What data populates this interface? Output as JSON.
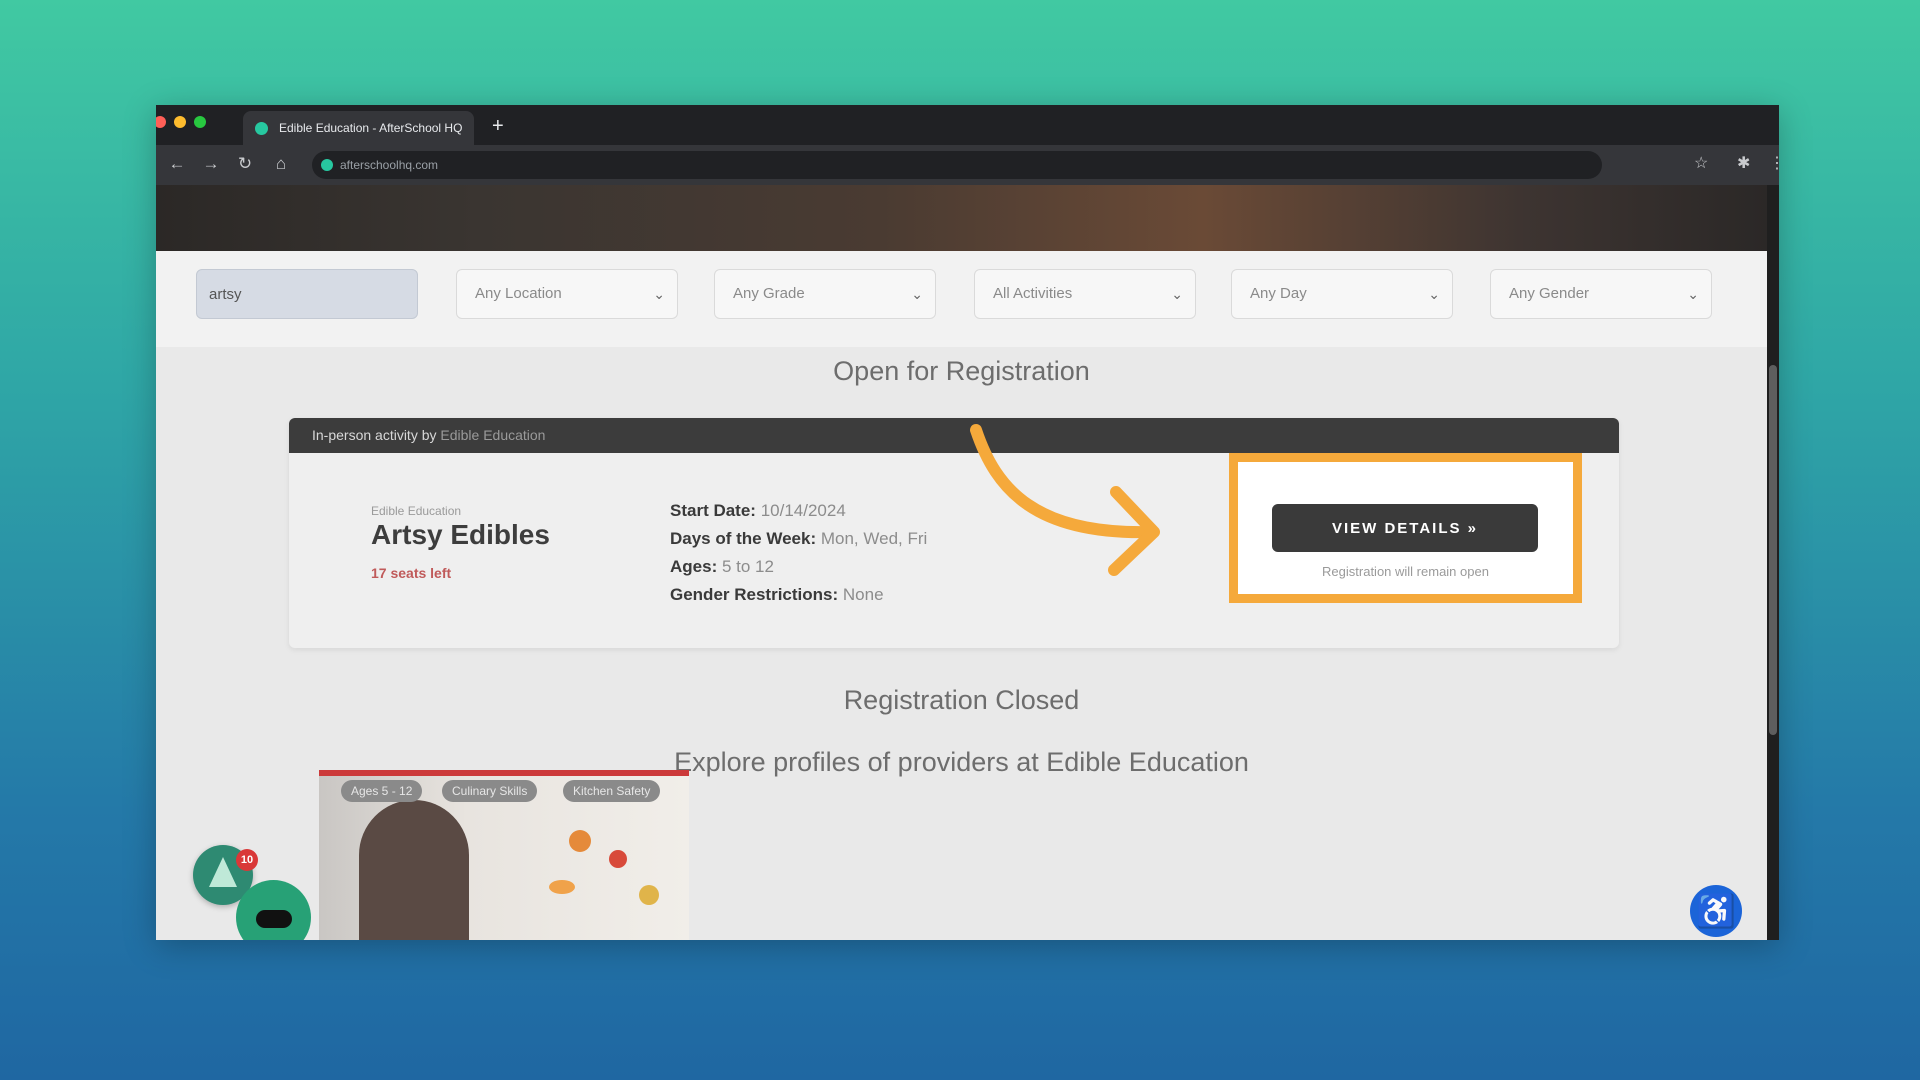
{
  "browser": {
    "tab_title": "Edible Education - AfterSchool HQ",
    "url": "afterschoolhq.com",
    "new_tab_glyph": "+",
    "back_glyph": "←",
    "forward_glyph": "→",
    "reload_glyph": "↻",
    "home_glyph": "⌂",
    "star_glyph": "☆",
    "extensions_glyph": "✱",
    "menu_glyph": "⋮"
  },
  "filters": {
    "search_value": "artsy",
    "location": "Any Location",
    "grade": "Any Grade",
    "activities": "All Activities",
    "day": "Any Day",
    "gender": "Any Gender",
    "chevron": "⌄"
  },
  "sections": {
    "open_title": "Open for Registration",
    "closed_title": "Registration Closed",
    "explore_title": "Explore profiles of providers at Edible Education"
  },
  "card": {
    "header_prefix": "In-person activity by",
    "header_provider": "Edible Education",
    "provider_small": "Edible Education",
    "title": "Artsy Edibles",
    "seats_left": "17 seats left",
    "start_date_label": "Start Date:",
    "start_date": "10/14/2024",
    "days_label": "Days of the Week:",
    "days": "Mon, Wed, Fri",
    "ages_label": "Ages:",
    "ages": "5 to 12",
    "gender_label": "Gender Restrictions:",
    "gender": "None",
    "button_label": "VIEW DETAILS »",
    "registration_note": "Registration will remain open"
  },
  "thumbnail": {
    "chips": [
      "Ages 5 - 12",
      "Culinary Skills",
      "Kitchen Safety"
    ]
  },
  "widgets": {
    "badge_count": "10",
    "accessibility_glyph": "♿"
  },
  "colors": {
    "highlight": "#f5a93b",
    "button": "#3a3a3a",
    "seats": "#c05a5a",
    "accessibility": "#1b64d8",
    "chat": "#27a176"
  }
}
